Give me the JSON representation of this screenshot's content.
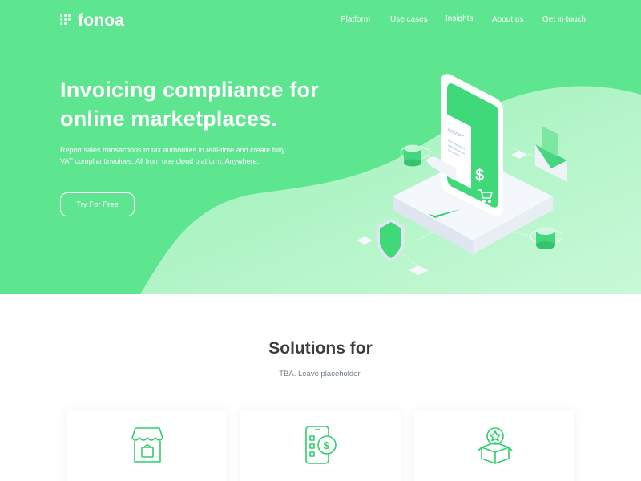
{
  "brand": {
    "name": "fonoa"
  },
  "nav": {
    "items": [
      {
        "label": "Platform"
      },
      {
        "label": "Use cases"
      },
      {
        "label": "Insights"
      },
      {
        "label": "About us"
      },
      {
        "label": "Get in touch"
      }
    ]
  },
  "hero": {
    "headline_line1": "Invoicing compliance for",
    "headline_line2": "online marketplaces.",
    "description_line1": "Report sales transactions to tax authorities in real-time and create fully",
    "description_line2": "VAT compliantinvoices. All from one cloud platform. Anywhere.",
    "cta_label": "Try For Free",
    "illustration": {
      "receipt_text": "RECEIPT",
      "icons": [
        "phone-icon",
        "receipt-icon",
        "dollar-icon",
        "cart-icon",
        "shield-icon",
        "coin-stack-icon",
        "envelope-icon",
        "checkmark-icon"
      ]
    }
  },
  "solutions": {
    "title": "Solutions for",
    "subtitle": "TBA. Leave placeholder.",
    "cards": [
      {
        "icon": "storefront-icon"
      },
      {
        "icon": "mobile-payment-icon"
      },
      {
        "icon": "award-box-icon"
      }
    ]
  },
  "colors": {
    "hero_green": "#5de58f",
    "wave_light": "#a6f5bf",
    "accent_green": "#2fcf6b",
    "text_dark": "#3d3d3d",
    "text_muted": "#6d7a86"
  }
}
